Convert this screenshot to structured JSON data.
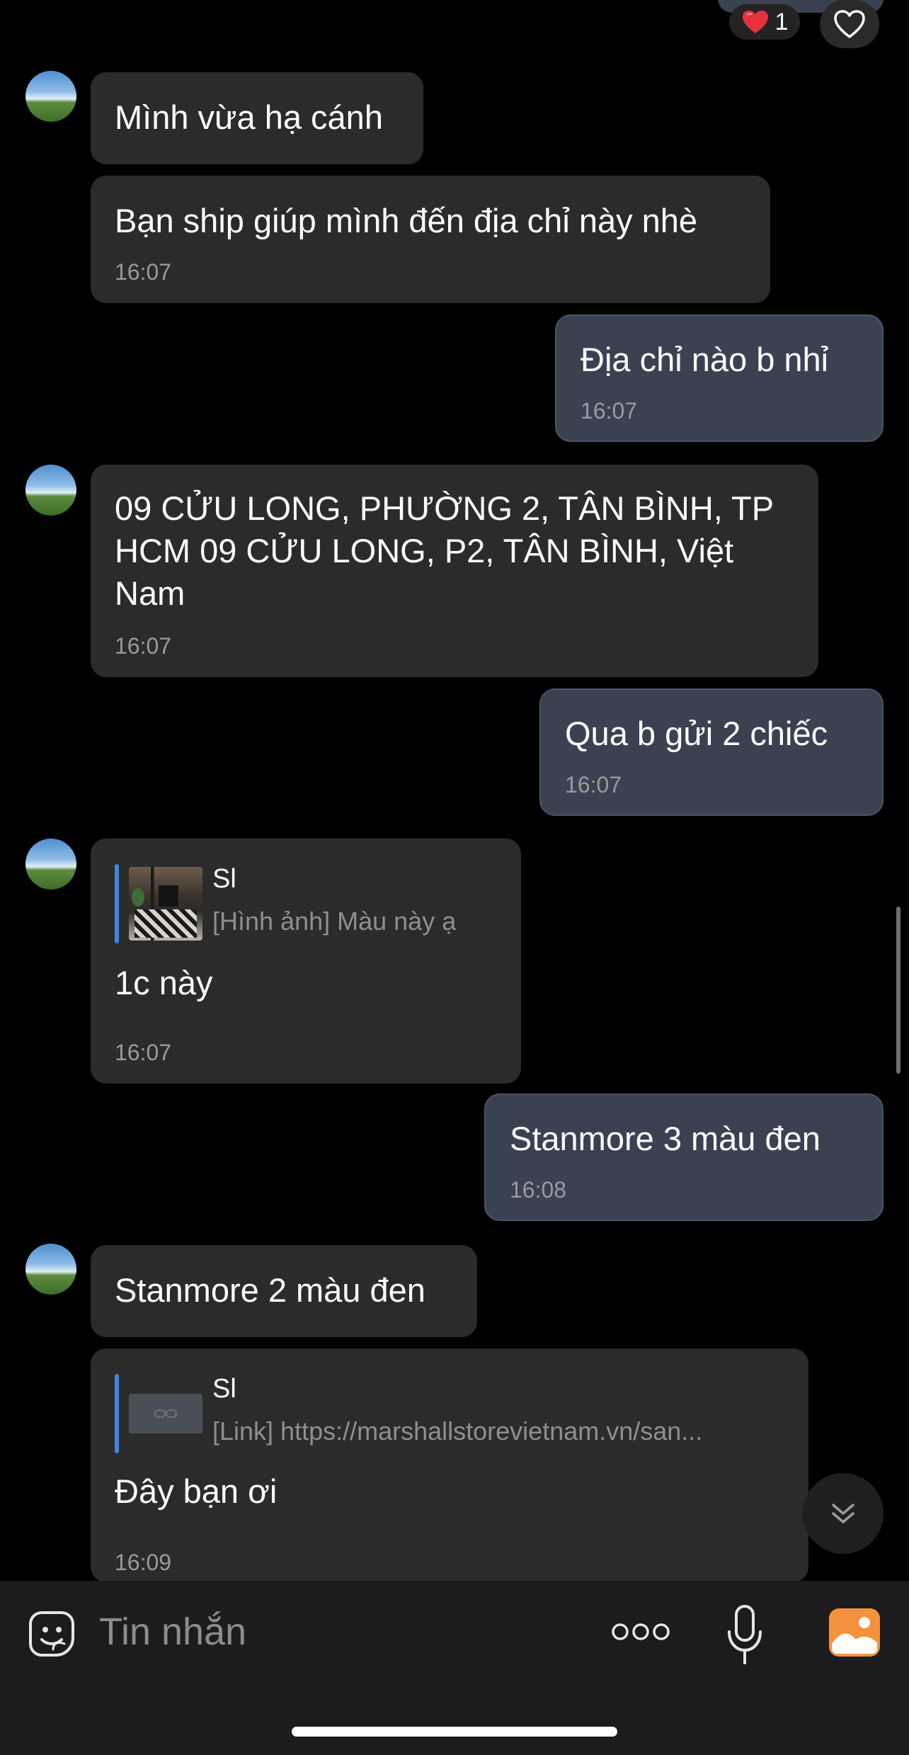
{
  "colors": {
    "background": "#000000",
    "incoming_bubble": "#2b2b2b",
    "outgoing_bubble": "#3a4252",
    "quote_accent": "#3f86e0",
    "gallery_accent": "#f5923e"
  },
  "top_reaction": {
    "emoji": "red-heart",
    "count": "1"
  },
  "messages": [
    {
      "direction": "incoming",
      "text": "Mình vừa hạ cánh",
      "time": ""
    },
    {
      "direction": "incoming",
      "text": "Bạn ship giúp mình đến địa chỉ này nhè",
      "time": "16:07"
    },
    {
      "direction": "outgoing",
      "text": "Địa chỉ nào b nhỉ",
      "time": "16:07"
    },
    {
      "direction": "incoming",
      "lines": [
        "09 CỬU LONG, PHƯỜNG 2, TÂN BÌNH, TP",
        "HCM 09 CỬU LONG, P2, TÂN BÌNH, Việt",
        "Nam"
      ],
      "time": "16:07"
    },
    {
      "direction": "outgoing",
      "text": "Qua b gửi 2 chiếc",
      "time": "16:07"
    },
    {
      "direction": "incoming",
      "quote": {
        "name": "Sl",
        "preview": "[Hình ảnh] Màu này ạ"
      },
      "text": "1c này",
      "time": "16:07"
    },
    {
      "direction": "outgoing",
      "text": "Stanmore 3 màu đen",
      "time": "16:08"
    },
    {
      "direction": "incoming",
      "text": "Stanmore 2 màu đen",
      "time": ""
    },
    {
      "direction": "incoming",
      "quote": {
        "name": "Sl",
        "preview": "[Link] https://marshallstorevietnam.vn/san..."
      },
      "text": "Đây bạn ơi",
      "time": "16:09"
    }
  ],
  "composer": {
    "placeholder": "Tin nhắn",
    "icons": [
      "sticker-icon",
      "more-icon",
      "microphone-icon",
      "gallery-icon"
    ]
  }
}
